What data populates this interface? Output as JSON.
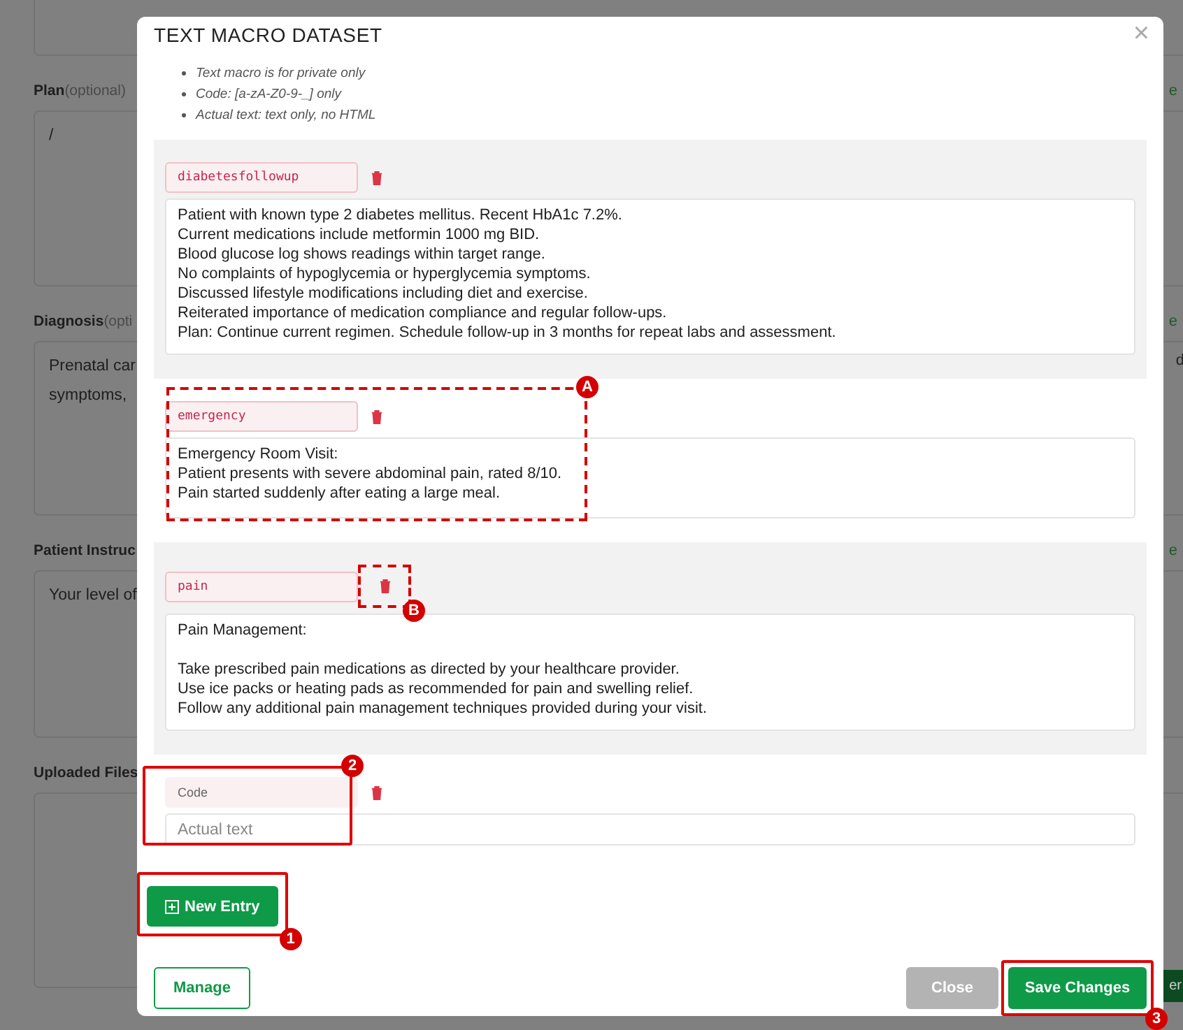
{
  "background": {
    "sections": [
      {
        "label": "Plan",
        "hint": "(optional)",
        "link": "e",
        "text": "/"
      },
      {
        "label": "Diagnosis",
        "hint": "(opti",
        "link": "e",
        "text": "Prenatal car\nsymptoms,",
        "right_text": "d"
      },
      {
        "label": "Patient Instruc",
        "link": "e",
        "text": "Your level of"
      },
      {
        "label": "Uploaded Files"
      }
    ],
    "button_fragment": "er"
  },
  "modal": {
    "title": "TEXT MACRO DATASET",
    "close": "×",
    "notes": [
      "Text macro is for private only",
      "Code: [a-zA-Z0-9-_] only",
      "Actual text: text only, no HTML"
    ],
    "entries": [
      {
        "code": "diabetesfollowup",
        "text": "Patient with known type 2 diabetes mellitus. Recent HbA1c 7.2%.\nCurrent medications include metformin 1000 mg BID.\nBlood glucose log shows readings within target range.\nNo complaints of hypoglycemia or hyperglycemia symptoms.\nDiscussed lifestyle modifications including diet and exercise.\nReiterated importance of medication compliance and regular follow-ups.\nPlan: Continue current regimen. Schedule follow-up in 3 months for repeat labs and assessment."
      },
      {
        "code": "emergency",
        "text": "Emergency Room Visit:\nPatient presents with severe abdominal pain, rated 8/10.\nPain started suddenly after eating a large meal.",
        "callout": {
          "label": "A"
        }
      },
      {
        "code": "pain",
        "text": "Pain Management:\n\nTake prescribed pain medications as directed by your healthcare provider.\nUse ice packs or heating pads as recommended for pain and swelling relief.\nFollow any additional pain management techniques provided during your visit.",
        "delete_callout": {
          "label": "B"
        }
      }
    ],
    "new_entry": {
      "code_placeholder": "Code",
      "text_placeholder": "Actual text",
      "callout": {
        "label": "2"
      }
    },
    "add_button": {
      "label": "New Entry",
      "callout": {
        "label": "1"
      }
    },
    "footer": {
      "manage": "Manage",
      "close": "Close",
      "save": "Save Changes",
      "save_callout": {
        "label": "3"
      }
    }
  }
}
